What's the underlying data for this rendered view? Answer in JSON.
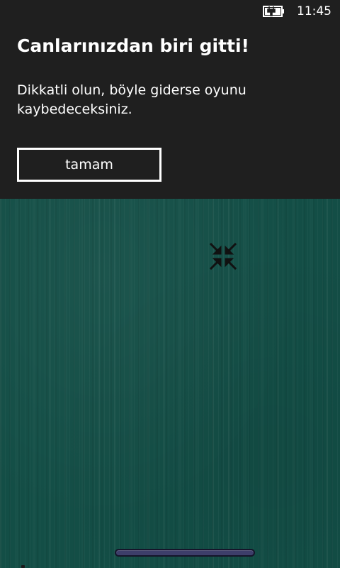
{
  "status_bar": {
    "time": "11:45",
    "battery_icon": "battery-charging-icon"
  },
  "dialog": {
    "title": "Canlarınızdan biri gitti!",
    "message": "Dikkatli olun, böyle giderse oyunu kaybedeceksiniz.",
    "ok_label": "tamam"
  },
  "game": {
    "minimize_icon": "minimize-arrows-icon",
    "paddle_icon": "paddle"
  },
  "colors": {
    "dialog_background": "#1f1f1f",
    "game_background": "#134e46",
    "paddle": "#3d3e6a",
    "text": "#ffffff"
  }
}
